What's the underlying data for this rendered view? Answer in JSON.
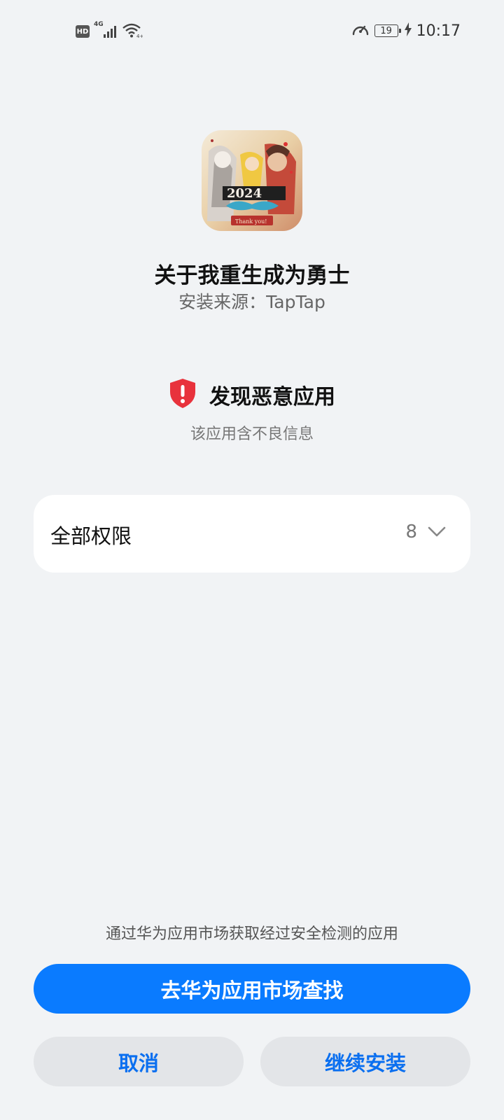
{
  "status_bar": {
    "hd": "HD",
    "network": "4G",
    "battery": "19",
    "time": "10:17"
  },
  "app": {
    "name": "关于我重生成为勇士",
    "source": "安装来源：TapTap",
    "icon": "game-artwork-icon"
  },
  "warning": {
    "title": "发现恶意应用",
    "description": "该应用含不良信息",
    "icon": "shield-alert-icon",
    "color": "#e8323c"
  },
  "permissions": {
    "label": "全部权限",
    "count": "8"
  },
  "footer": {
    "note": "通过华为应用市场获取经过安全检测的应用",
    "primary_button": "去华为应用市场查找",
    "cancel_button": "取消",
    "continue_button": "继续安装"
  },
  "colors": {
    "background": "#f1f3f5",
    "primary": "#0a7bff",
    "secondary_text": "#0a6ff0"
  }
}
